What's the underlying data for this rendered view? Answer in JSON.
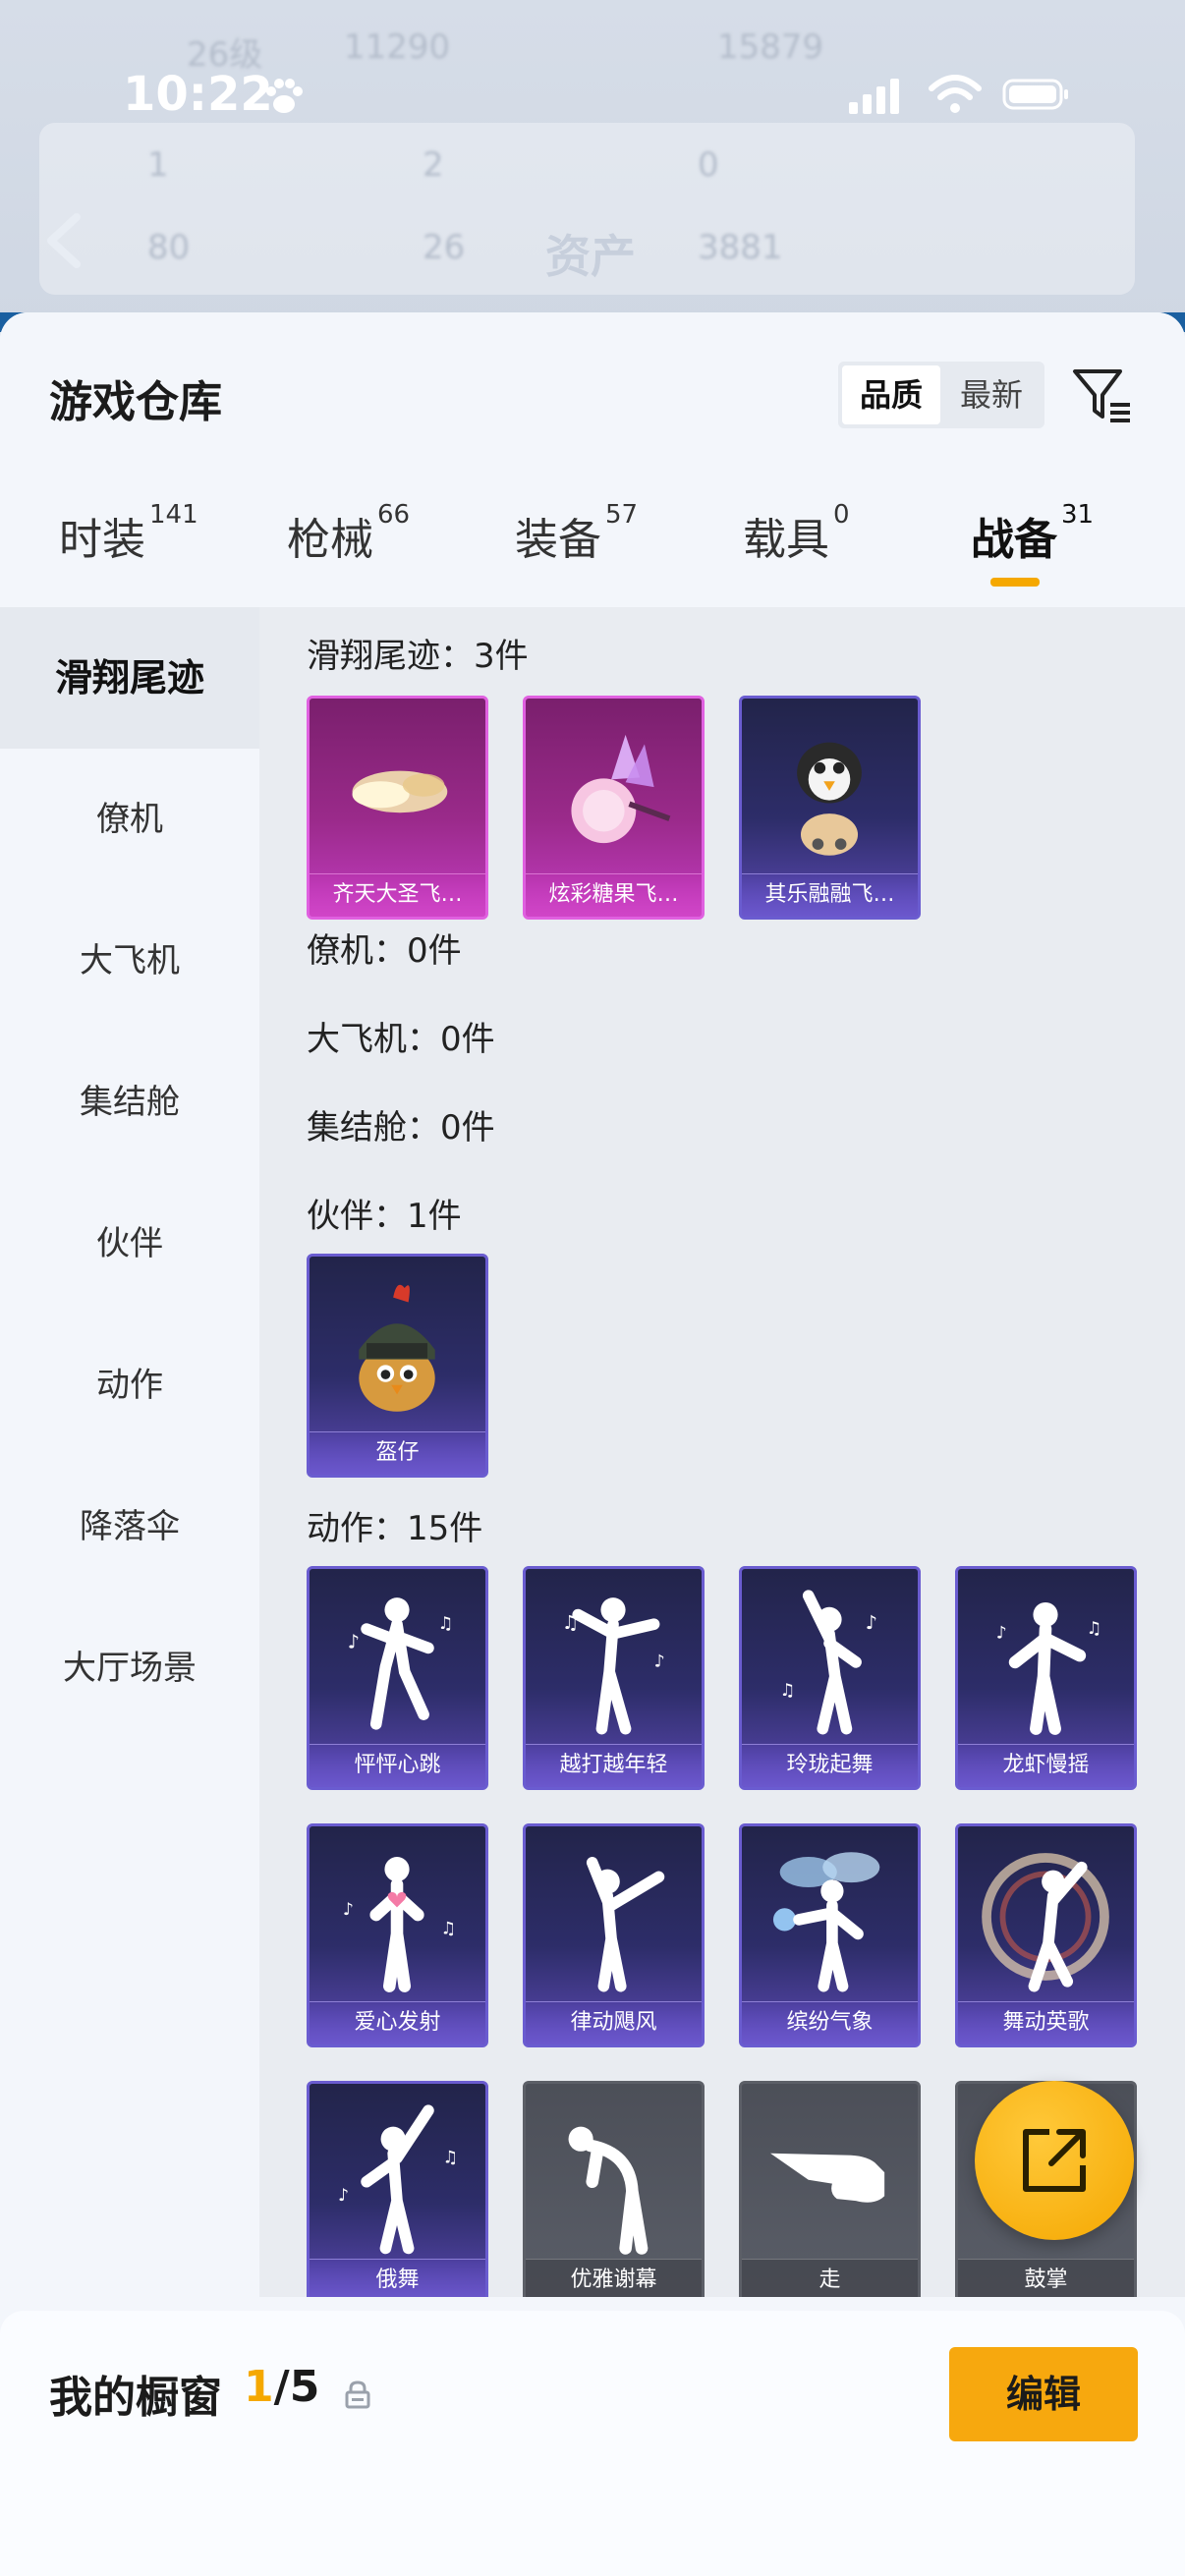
{
  "status_bar": {
    "time": "10:22"
  },
  "background_header": {
    "title": "资产",
    "row1": [
      "26级",
      "11290",
      "15879"
    ],
    "row2": [
      "1",
      "2",
      "0"
    ],
    "row3": [
      "80",
      "26",
      "3881"
    ]
  },
  "sheet": {
    "title": "游戏仓库",
    "sort": {
      "quality": "品质",
      "newest": "最新"
    }
  },
  "tabs": [
    {
      "label": "时装",
      "count": "141"
    },
    {
      "label": "枪械",
      "count": "66"
    },
    {
      "label": "装备",
      "count": "57"
    },
    {
      "label": "载具",
      "count": "0"
    },
    {
      "label": "战备",
      "count": "31"
    }
  ],
  "sidebar": {
    "items": [
      {
        "label": "滑翔尾迹"
      },
      {
        "label": "僚机"
      },
      {
        "label": "大飞机"
      },
      {
        "label": "集结舱"
      },
      {
        "label": "伙伴"
      },
      {
        "label": "动作"
      },
      {
        "label": "降落伞"
      },
      {
        "label": "大厅场景"
      }
    ]
  },
  "sections": {
    "glide": {
      "title": "滑翔尾迹：3件",
      "items": [
        "齐天大圣飞…",
        "炫彩糖果飞…",
        "其乐融融飞…"
      ]
    },
    "wingman": {
      "title": "僚机：0件"
    },
    "plane": {
      "title": "大飞机：0件"
    },
    "capsule": {
      "title": "集结舱：0件"
    },
    "partner": {
      "title": "伙伴：1件",
      "items": [
        "盔仔"
      ]
    },
    "emote": {
      "title": "动作：15件",
      "items": [
        "怦怦心跳",
        "越打越年轻",
        "玲珑起舞",
        "龙虾慢摇",
        "爱心发射",
        "律动飓风",
        "缤纷气象",
        "舞动英歌",
        "俄舞",
        "优雅谢幕",
        "走",
        "鼓掌"
      ]
    }
  },
  "bottom": {
    "label": "我的橱窗",
    "current": "1",
    "total": "/5",
    "edit": "编辑"
  },
  "colors": {
    "accent": "#f5a800",
    "card_purple": "#5a48b0",
    "card_pink": "#c23cc0",
    "card_gray": "#5a5e68"
  }
}
